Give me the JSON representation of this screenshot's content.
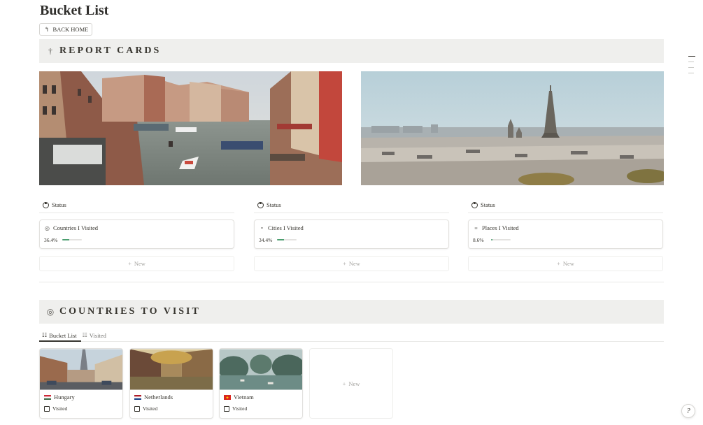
{
  "page": {
    "title": "Bucket List"
  },
  "back_button": {
    "label": "BACK HOME",
    "icon": "back-arrow-icon"
  },
  "report_section": {
    "title": "REPORT CARDS",
    "icon": "pin-icon"
  },
  "status_columns": [
    {
      "header": "Status",
      "card_title": "Countries I Visited",
      "card_icon": "globe-icon",
      "percent_label": "36.4%",
      "progress": 0.364,
      "new_label": "New"
    },
    {
      "header": "Status",
      "card_title": "Cities I Visited",
      "card_icon": "map-pin-icon",
      "percent_label": "34.4%",
      "progress": 0.344,
      "new_label": "New"
    },
    {
      "header": "Status",
      "card_title": "Places I Visited",
      "card_icon": "landmark-icon",
      "percent_label": "8.6%",
      "progress": 0.086,
      "new_label": "New"
    }
  ],
  "countries_section": {
    "title": "COUNTRIES TO VISIT",
    "icon": "globe-icon"
  },
  "tabs": [
    {
      "label": "Bucket List",
      "icon": "gallery-icon",
      "active": true
    },
    {
      "label": "Visited",
      "icon": "gallery-icon",
      "active": false
    }
  ],
  "gallery": [
    {
      "name": "Hungary",
      "checkbox_label": "Visited",
      "checked": false,
      "flag": "hungary-flag-icon"
    },
    {
      "name": "Netherlands",
      "checkbox_label": "Visited",
      "checked": false,
      "flag": "netherlands-flag-icon"
    },
    {
      "name": "Vietnam",
      "checkbox_label": "Visited",
      "checked": false,
      "flag": "vietnam-flag-icon"
    }
  ],
  "gallery_new_label": "New",
  "colors": {
    "progress_fill": "#4c9f70",
    "section_bg": "#efefed",
    "text": "#37352f"
  }
}
